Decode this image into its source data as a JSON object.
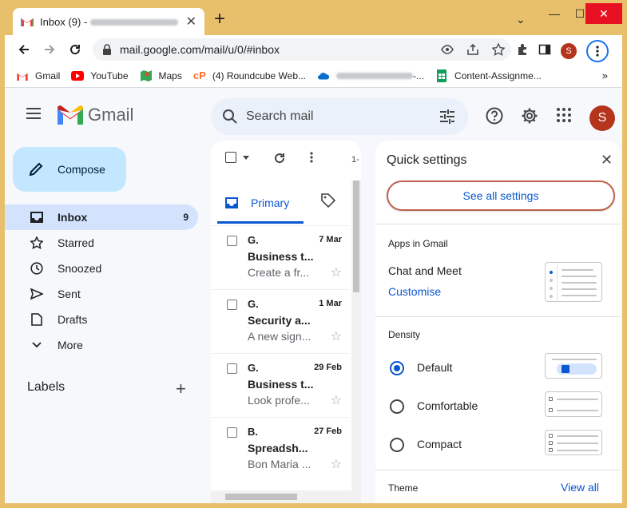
{
  "browser": {
    "tab_title": "Inbox (9) -",
    "tab_close": "✕",
    "new_tab": "+",
    "url": "mail.google.com/mail/u/0/#inbox",
    "profile_initial": "S",
    "window_controls": {
      "minimize": "—",
      "maximize": "☐",
      "close": "✕",
      "tab_search": "⌄"
    }
  },
  "bookmarks": [
    {
      "label": "Gmail",
      "icon": "gmail-icon"
    },
    {
      "label": "YouTube",
      "icon": "youtube-icon"
    },
    {
      "label": "Maps",
      "icon": "maps-icon"
    },
    {
      "label": "(4) Roundcube Web...",
      "icon": "cpanel-icon"
    },
    {
      "label": "-...",
      "icon": "onedrive-icon"
    },
    {
      "label": "Content-Assignme...",
      "icon": "sheets-icon"
    }
  ],
  "bookmarks_more": "»",
  "gmail": {
    "logo_text": "Gmail",
    "search_placeholder": "Search mail",
    "avatar_initial": "S",
    "compose_label": "Compose",
    "nav": [
      {
        "label": "Inbox",
        "count": "9",
        "icon": "inbox-icon",
        "active": true
      },
      {
        "label": "Starred",
        "count": "",
        "icon": "star-icon"
      },
      {
        "label": "Snoozed",
        "count": "",
        "icon": "clock-icon"
      },
      {
        "label": "Sent",
        "count": "",
        "icon": "send-icon"
      },
      {
        "label": "Drafts",
        "count": "",
        "icon": "draft-icon"
      },
      {
        "label": "More",
        "count": "",
        "icon": "chevron-down-icon"
      }
    ],
    "labels_heading": "Labels",
    "labels_add": "+",
    "list_pager": "1-",
    "primary_tab": "Primary",
    "emails": [
      {
        "sender": "G.",
        "date": "7 Mar",
        "subject": "Business t...",
        "snippet": "Create a fr..."
      },
      {
        "sender": "G.",
        "date": "1 Mar",
        "subject": "Security a...",
        "snippet": "A new sign..."
      },
      {
        "sender": "G.",
        "date": "29 Feb",
        "subject": "Business t...",
        "snippet": "Look profe..."
      },
      {
        "sender": "B.",
        "date": "27 Feb",
        "subject": "Spreadsh...",
        "snippet": "Bon Maria ..."
      }
    ]
  },
  "quick_settings": {
    "title": "Quick settings",
    "close": "✕",
    "see_all": "See all settings",
    "apps_heading": "Apps in Gmail",
    "chat_meet": "Chat and Meet",
    "customise": "Customise",
    "density_heading": "Density",
    "density_options": [
      {
        "label": "Default",
        "selected": true
      },
      {
        "label": "Comfortable",
        "selected": false
      },
      {
        "label": "Compact",
        "selected": false
      }
    ],
    "theme_heading": "Theme",
    "view_all": "View all"
  }
}
